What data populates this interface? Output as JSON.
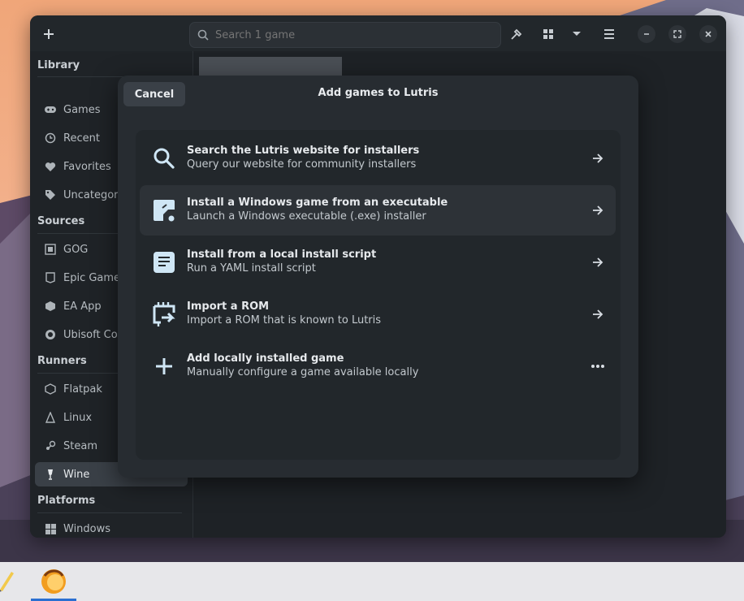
{
  "headerbar": {
    "search_placeholder": "Search 1 game"
  },
  "sidebar": {
    "library_label": "Library",
    "library_items": [
      "Games",
      "Recent",
      "Favorites",
      "Uncategori"
    ],
    "sources_label": "Sources",
    "sources_items": [
      "GOG",
      "Epic Game",
      "EA App",
      "Ubisoft Cor"
    ],
    "runners_label": "Runners",
    "runners_items": [
      "Flatpak",
      "Linux",
      "Steam",
      "Wine"
    ],
    "platforms_label": "Platforms",
    "platforms_items": [
      "Windows"
    ]
  },
  "dialog": {
    "title": "Add games to Lutris",
    "cancel_label": "Cancel",
    "options": [
      {
        "title": "Search the Lutris website for installers",
        "subtitle": "Query our website for community installers",
        "icon": "search-icon"
      },
      {
        "title": "Install a Windows game from an executable",
        "subtitle": "Launch a Windows executable (.exe) installer",
        "icon": "windows-exe-icon"
      },
      {
        "title": "Install from a local install script",
        "subtitle": "Run a YAML install script",
        "icon": "script-icon"
      },
      {
        "title": "Import a ROM",
        "subtitle": "Import a ROM that is known to Lutris",
        "icon": "rom-icon"
      },
      {
        "title": "Add locally installed game",
        "subtitle": "Manually configure a game available locally",
        "icon": "plus-icon"
      }
    ]
  },
  "colors": {
    "window_bg": "#1e2226",
    "dialog_bg": "#272c31",
    "accent_icon": "#cfe6f5"
  }
}
